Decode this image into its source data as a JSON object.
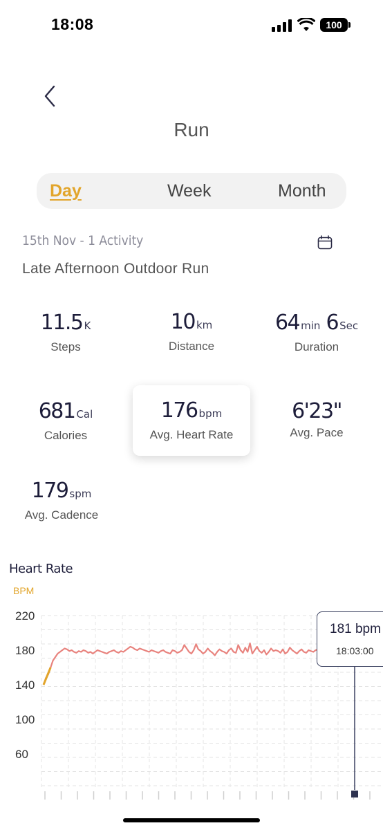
{
  "status_bar": {
    "time": "18:08",
    "battery": "100"
  },
  "header": {
    "title": "Run"
  },
  "tabs": [
    {
      "label": "Day",
      "active": true
    },
    {
      "label": "Week",
      "active": false
    },
    {
      "label": "Month",
      "active": false
    }
  ],
  "summary": {
    "date_line": "15th Nov - 1 Activity",
    "activity_title": "Late Afternoon Outdoor Run"
  },
  "stats": {
    "steps": {
      "value": "11.5",
      "unit": "K",
      "label": "Steps"
    },
    "distance": {
      "value": "10",
      "unit": "km",
      "label": "Distance"
    },
    "duration": {
      "value1": "64",
      "unit1": "min",
      "value2": "6",
      "unit2": "Sec",
      "label": "Duration"
    },
    "calories": {
      "value": "681",
      "unit": "Cal",
      "label": "Calories"
    },
    "heart_rate": {
      "value": "176",
      "unit": "bpm",
      "label": "Avg. Heart Rate"
    },
    "pace": {
      "value": "6'23\"",
      "label": "Avg. Pace"
    },
    "cadence": {
      "value": "179",
      "unit": "spm",
      "label": "Avg. Cadence"
    }
  },
  "chart": {
    "title": "Heart Rate",
    "unit_label": "BPM",
    "tooltip_value": "181 bpm",
    "tooltip_time": "18:03:00"
  },
  "colors": {
    "accent": "#e2a52b",
    "line": "#e8837e",
    "text_dark": "#1d1d3a"
  },
  "chart_data": {
    "type": "line",
    "title": "Heart Rate",
    "ylabel": "BPM",
    "yticks": [
      220,
      180,
      140,
      100,
      60
    ],
    "ylim": [
      20,
      220
    ],
    "series": [
      {
        "values": [
          140,
          148,
          152,
          160,
          168,
          172,
          176,
          178,
          180,
          182,
          181,
          179,
          180,
          178,
          177,
          179,
          178,
          180,
          179,
          177,
          178,
          176,
          178,
          180,
          179,
          178,
          177,
          176,
          178,
          179,
          180,
          178,
          177,
          179,
          178,
          180,
          182,
          184,
          183,
          181,
          180,
          182,
          181,
          180,
          179,
          178,
          180,
          179,
          178,
          177,
          179,
          180,
          178,
          177,
          176,
          180,
          179,
          177,
          178,
          180,
          186,
          182,
          178,
          176,
          180,
          187,
          181,
          179,
          176,
          178,
          182,
          179,
          177,
          174,
          178,
          181,
          179,
          178,
          176,
          180,
          182,
          178,
          177,
          186,
          180,
          177,
          183,
          178,
          188,
          176,
          180,
          184,
          179,
          177,
          180,
          175,
          178,
          182,
          179,
          180,
          179,
          177,
          181,
          176,
          178,
          183,
          180,
          178,
          176,
          179,
          181,
          178,
          177,
          180,
          179,
          178,
          180,
          181
        ]
      }
    ],
    "grid": true
  }
}
